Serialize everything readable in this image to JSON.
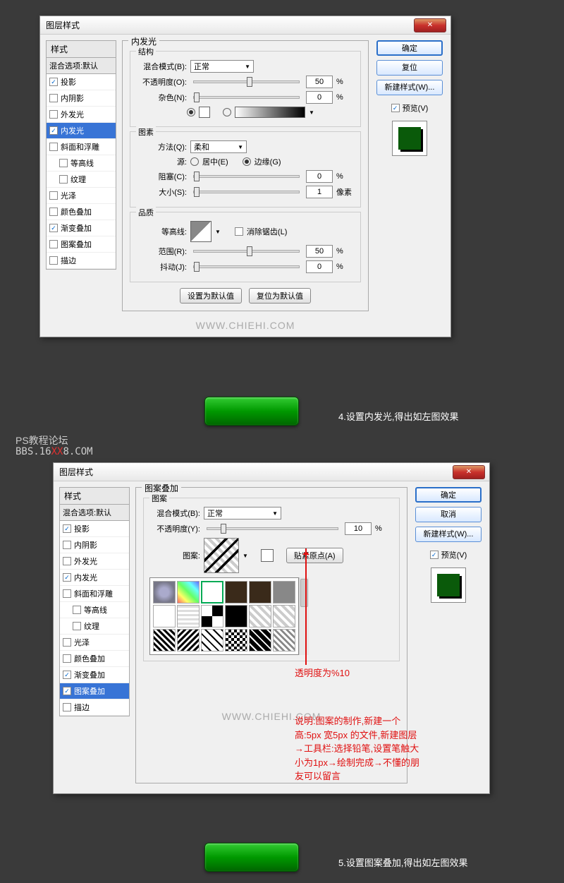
{
  "dialog1": {
    "title": "图层样式",
    "styles_header": "样式",
    "blend_header": "混合选项:默认",
    "items": [
      {
        "label": "投影",
        "checked": true,
        "selected": false
      },
      {
        "label": "内阴影",
        "checked": false,
        "selected": false
      },
      {
        "label": "外发光",
        "checked": false,
        "selected": false
      },
      {
        "label": "内发光",
        "checked": true,
        "selected": true
      },
      {
        "label": "斜面和浮雕",
        "checked": false,
        "selected": false
      },
      {
        "label": "等高线",
        "checked": false,
        "selected": false,
        "indent": true
      },
      {
        "label": "纹理",
        "checked": false,
        "selected": false,
        "indent": true
      },
      {
        "label": "光泽",
        "checked": false,
        "selected": false
      },
      {
        "label": "颜色叠加",
        "checked": false,
        "selected": false
      },
      {
        "label": "渐变叠加",
        "checked": true,
        "selected": false
      },
      {
        "label": "图案叠加",
        "checked": false,
        "selected": false
      },
      {
        "label": "描边",
        "checked": false,
        "selected": false
      }
    ],
    "panel_title": "内发光",
    "struct_title": "结构",
    "blend_mode_label": "混合模式(B):",
    "blend_mode_value": "正常",
    "opacity_label": "不透明度(O):",
    "opacity_value": "50",
    "opacity_unit": "%",
    "noise_label": "杂色(N):",
    "noise_value": "0",
    "noise_unit": "%",
    "elements_title": "图素",
    "method_label": "方法(Q):",
    "method_value": "柔和",
    "source_label": "源:",
    "source_center": "居中(E)",
    "source_edge": "边缘(G)",
    "choke_label": "阻塞(C):",
    "choke_value": "0",
    "choke_unit": "%",
    "size_label": "大小(S):",
    "size_value": "1",
    "size_unit": "像素",
    "quality_title": "品质",
    "contour_label": "等高线:",
    "antialias_label": "消除锯齿(L)",
    "range_label": "范围(R):",
    "range_value": "50",
    "range_unit": "%",
    "jitter_label": "抖动(J):",
    "jitter_value": "0",
    "jitter_unit": "%",
    "default_btn": "设置为默认值",
    "reset_btn": "复位为默认值",
    "ok": "确定",
    "reset": "复位",
    "new_style": "新建样式(W)...",
    "preview": "预览(V)",
    "watermark": "WWW.CHIEHI.COM"
  },
  "caption1": "4.设置内发光,得出如左图效果",
  "forum": "PS教程论坛",
  "forum_url_pre": "BBS.16",
  "forum_url_red": "XX",
  "forum_url_post": "8.COM",
  "dialog2": {
    "title": "图层样式",
    "styles_header": "样式",
    "blend_header": "混合选项:默认",
    "items": [
      {
        "label": "投影",
        "checked": true,
        "selected": false
      },
      {
        "label": "内阴影",
        "checked": false,
        "selected": false
      },
      {
        "label": "外发光",
        "checked": false,
        "selected": false
      },
      {
        "label": "内发光",
        "checked": true,
        "selected": false
      },
      {
        "label": "斜面和浮雕",
        "checked": false,
        "selected": false
      },
      {
        "label": "等高线",
        "checked": false,
        "selected": false,
        "indent": true
      },
      {
        "label": "纹理",
        "checked": false,
        "selected": false,
        "indent": true
      },
      {
        "label": "光泽",
        "checked": false,
        "selected": false
      },
      {
        "label": "颜色叠加",
        "checked": false,
        "selected": false
      },
      {
        "label": "渐变叠加",
        "checked": true,
        "selected": false
      },
      {
        "label": "图案叠加",
        "checked": true,
        "selected": true
      },
      {
        "label": "描边",
        "checked": false,
        "selected": false
      }
    ],
    "panel_title": "图案叠加",
    "pattern_title": "图案",
    "blend_mode_label": "混合模式(B):",
    "blend_mode_value": "正常",
    "opacity_label": "不透明度(Y):",
    "opacity_value": "10",
    "opacity_unit": "%",
    "pattern_label": "图案:",
    "snap_label": "贴紧原点(A)",
    "ok": "确定",
    "cancel": "取消",
    "new_style": "新建样式(W)...",
    "preview": "预览(V)",
    "watermark": "WWW.CHIEHI.COM"
  },
  "anno1": "透明度为%10",
  "anno2": "说明:图案的制作,新建一个高:5px 宽5px 的文件,新建图层→工具栏:选择铅笔,设置笔触大小为1px→绘制完成→不懂的朋友可以留言",
  "caption2": "5.设置图案叠加,得出如左图效果"
}
